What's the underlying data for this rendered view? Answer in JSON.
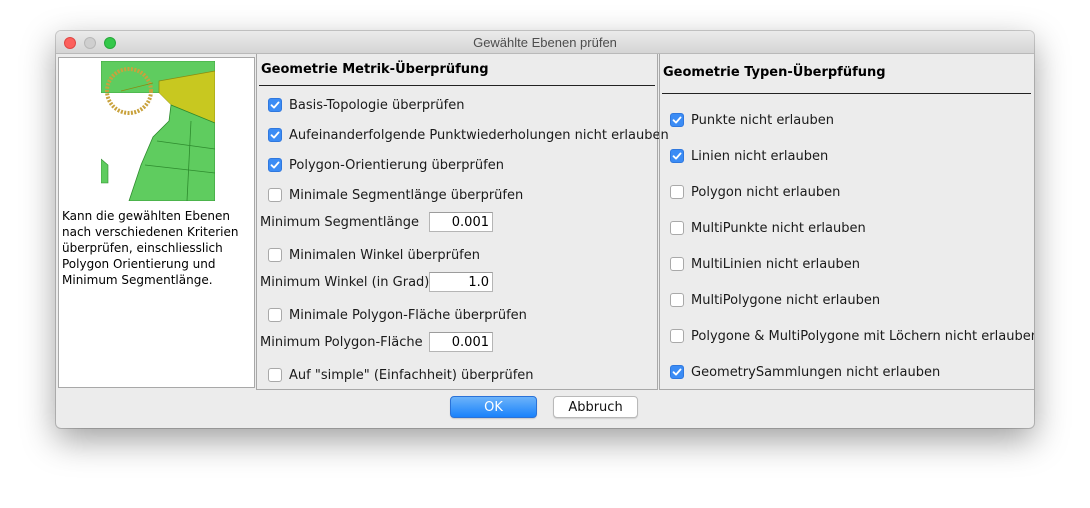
{
  "window": {
    "title": "Gewählte Ebenen prüfen"
  },
  "left_panel": {
    "description": "Kann die gewählten Ebenen nach verschiedenen Kriterien überprüfen, einschliesslich Polygon Orientierung und Minimum Segmentlänge."
  },
  "metric": {
    "title": "Geometrie Metrik-Überprüfung",
    "basis_topologie": {
      "label": "Basis-Topologie überprüfen",
      "checked": true
    },
    "punktwiederholungen": {
      "label": "Aufeinanderfolgende Punktwiederholungen nicht erlauben",
      "checked": true
    },
    "polygon_orientierung": {
      "label": "Polygon-Orientierung überprüfen",
      "checked": true
    },
    "min_segmentlaenge_check": {
      "label": "Minimale Segmentlänge überprüfen",
      "checked": false
    },
    "min_segmentlaenge_field": {
      "label": "Minimum Segmentlänge",
      "value": "0.001"
    },
    "min_winkel_check": {
      "label": "Minimalen Winkel überprüfen",
      "checked": false
    },
    "min_winkel_field": {
      "label": "Minimum Winkel (in Grad)",
      "value": "1.0"
    },
    "min_flaeche_check": {
      "label": "Minimale Polygon-Fläche überprüfen",
      "checked": false
    },
    "min_flaeche_field": {
      "label": "Minimum Polygon-Fläche",
      "value": "0.001"
    },
    "simple_check": {
      "label": "Auf \"simple\" (Einfachheit) überprüfen",
      "checked": false
    }
  },
  "types": {
    "title": "Geometrie Typen-Überpfüfung",
    "punkte": {
      "label": "Punkte nicht erlauben",
      "checked": true
    },
    "linien": {
      "label": "Linien  nicht erlauben",
      "checked": true
    },
    "polygon": {
      "label": "Polygon  nicht erlauben",
      "checked": false
    },
    "multipunkte": {
      "label": "MultiPunkte nicht erlauben",
      "checked": false
    },
    "multilinien": {
      "label": "MultiLinien nicht erlauben",
      "checked": false
    },
    "multipolygone": {
      "label": "MultiPolygone nicht erlauben",
      "checked": false
    },
    "loecher": {
      "label": "Polygone & MultiPolygone mit Löchern nicht erlauben",
      "checked": false
    },
    "sammlungen": {
      "label": "GeometrySammlungen nicht erlauben",
      "checked": true
    }
  },
  "buttons": {
    "ok": "OK",
    "cancel": "Abbruch"
  },
  "colors": {
    "accent": "#3b8cf5",
    "polygon_fill": "#5fcc5f",
    "highlight_fill": "#c8c820",
    "ring": "#c9a23c"
  }
}
